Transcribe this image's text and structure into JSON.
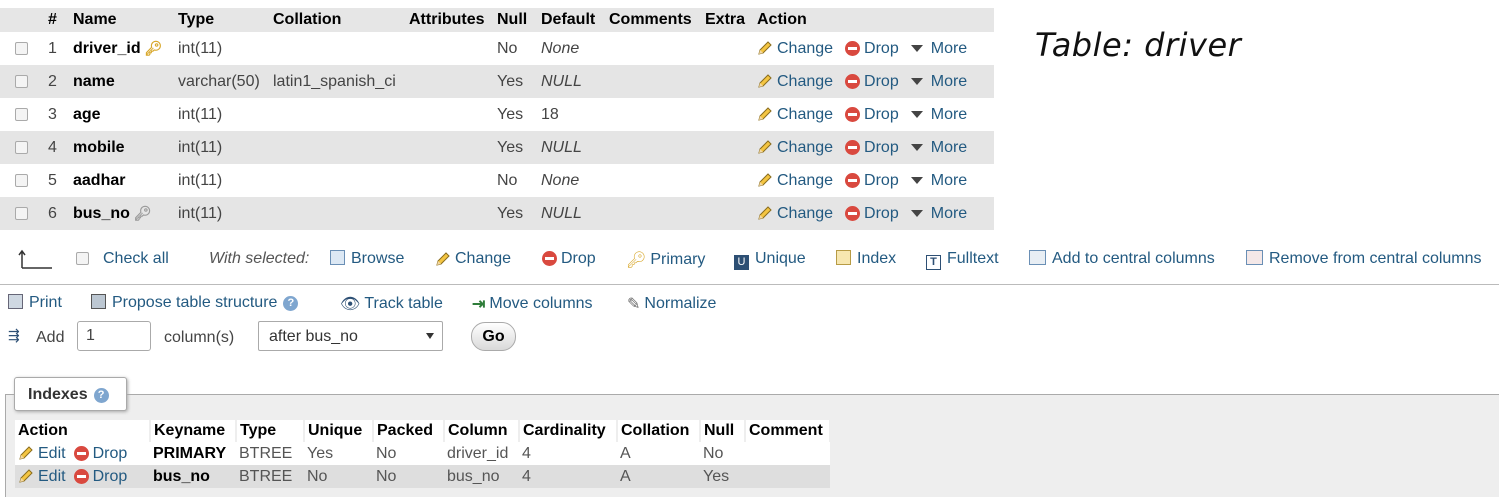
{
  "title_annotation": "Table: driver",
  "structure": {
    "headers": [
      "#",
      "Name",
      "Type",
      "Collation",
      "Attributes",
      "Null",
      "Default",
      "Comments",
      "Extra",
      "Action"
    ],
    "rows": [
      {
        "num": "1",
        "name": "driver_id",
        "key": "primary",
        "type": "int(11)",
        "collation": "",
        "attributes": "",
        "null": "No",
        "default": "None",
        "default_italic": true,
        "comments": "",
        "extra": ""
      },
      {
        "num": "2",
        "name": "name",
        "key": "",
        "type": "varchar(50)",
        "collation": "latin1_spanish_ci",
        "attributes": "",
        "null": "Yes",
        "default": "NULL",
        "default_italic": true,
        "comments": "",
        "extra": ""
      },
      {
        "num": "3",
        "name": "age",
        "key": "",
        "type": "int(11)",
        "collation": "",
        "attributes": "",
        "null": "Yes",
        "default": "18",
        "default_italic": false,
        "comments": "",
        "extra": ""
      },
      {
        "num": "4",
        "name": "mobile",
        "key": "",
        "type": "int(11)",
        "collation": "",
        "attributes": "",
        "null": "Yes",
        "default": "NULL",
        "default_italic": true,
        "comments": "",
        "extra": ""
      },
      {
        "num": "5",
        "name": "aadhar",
        "key": "",
        "type": "int(11)",
        "collation": "",
        "attributes": "",
        "null": "No",
        "default": "None",
        "default_italic": true,
        "comments": "",
        "extra": ""
      },
      {
        "num": "6",
        "name": "bus_no",
        "key": "index",
        "type": "int(11)",
        "collation": "",
        "attributes": "",
        "null": "Yes",
        "default": "NULL",
        "default_italic": true,
        "comments": "",
        "extra": ""
      }
    ],
    "actions": {
      "change": "Change",
      "drop": "Drop",
      "more": "More"
    }
  },
  "with_selected": {
    "check_all": "Check all",
    "label": "With selected:",
    "items": [
      "Browse",
      "Change",
      "Drop",
      "Primary",
      "Unique",
      "Index",
      "Fulltext",
      "Add to central columns",
      "Remove from central columns"
    ]
  },
  "ops": {
    "print": "Print",
    "propose": "Propose table structure",
    "track": "Track table",
    "move": "Move columns",
    "normalize": "Normalize"
  },
  "add_column": {
    "label": "Add",
    "count": "1",
    "unit": "column(s)",
    "position": "after bus_no",
    "go": "Go"
  },
  "indexes": {
    "legend": "Indexes",
    "headers": [
      "Action",
      "Keyname",
      "Type",
      "Unique",
      "Packed",
      "Column",
      "Cardinality",
      "Collation",
      "Null",
      "Comment"
    ],
    "edit": "Edit",
    "drop": "Drop",
    "rows": [
      {
        "keyname": "PRIMARY",
        "type": "BTREE",
        "unique": "Yes",
        "packed": "No",
        "column": "driver_id",
        "cardinality": "4",
        "collation": "A",
        "null": "No",
        "comment": ""
      },
      {
        "keyname": "bus_no",
        "type": "BTREE",
        "unique": "No",
        "packed": "No",
        "column": "bus_no",
        "cardinality": "4",
        "collation": "A",
        "null": "Yes",
        "comment": ""
      }
    ]
  },
  "colors": {
    "link": "#235a81",
    "drop_icon": "#d9493f",
    "key_icon": "#d8a72a",
    "row_alt": "#e5e5e5"
  }
}
